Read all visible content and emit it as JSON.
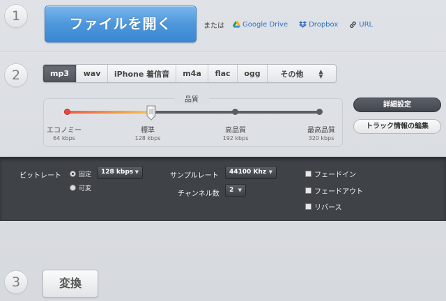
{
  "steps": {
    "one": "1",
    "two": "2",
    "three": "3"
  },
  "open_file": {
    "label": "ファイルを開く"
  },
  "sources": {
    "or_text": "または",
    "google_drive": "Google Drive",
    "dropbox": "Dropbox",
    "url": "URL"
  },
  "formats": {
    "mp3": "mp3",
    "wav": "wav",
    "iphone": "iPhone 着信音",
    "m4a": "m4a",
    "flac": "flac",
    "ogg": "ogg",
    "other": "その他",
    "selected": "mp3"
  },
  "quality": {
    "title": "品質",
    "selected_index": 1,
    "levels": [
      {
        "label": "エコノミー",
        "kbps": "64 kbps"
      },
      {
        "label": "標準",
        "kbps": "128 kbps"
      },
      {
        "label": "高品質",
        "kbps": "192 kbps"
      },
      {
        "label": "最高品質",
        "kbps": "320 kbps"
      }
    ]
  },
  "buttons": {
    "advanced": "詳細設定",
    "track_info": "トラック情報の編集",
    "convert": "変換"
  },
  "advanced": {
    "bitrate_label": "ビットレート",
    "bitrate_fixed": "固定",
    "bitrate_variable": "可変",
    "bitrate_mode": "固定",
    "bitrate_value": "128 kbps",
    "samplerate_label": "サンプルレート",
    "samplerate_value": "44100 Khz",
    "channels_label": "チャンネル数",
    "channels_value": "2",
    "fade_in": "フェードイン",
    "fade_out": "フェードアウト",
    "reverse": "リバース"
  },
  "colors": {
    "accent_blue": "#4d97dc",
    "active_tab": "#50555c",
    "slider_fill_start": "#ee5a4a",
    "slider_fill_end": "#f2c55b",
    "dark_panel": "#3f4348"
  }
}
